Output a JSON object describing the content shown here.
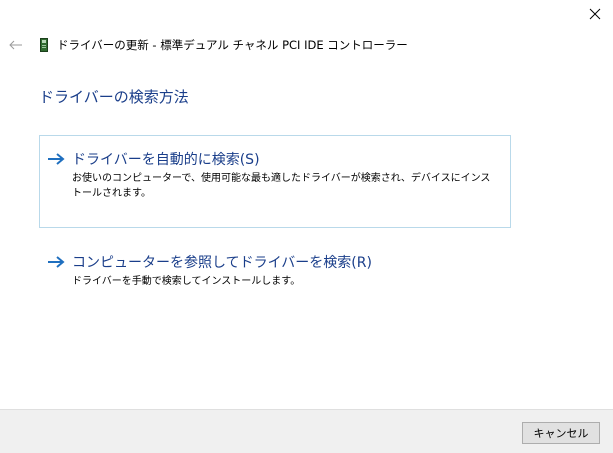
{
  "window": {
    "title": "ドライバーの更新 - 標準デュアル チャネル PCI IDE コントローラー",
    "close_icon": "close-icon",
    "back_icon": "back-arrow-icon",
    "device_icon": "device-icon"
  },
  "page": {
    "heading": "ドライバーの検索方法"
  },
  "options": [
    {
      "label": "ドライバーを自動的に検索(S)",
      "description": "お使いのコンピューターで、使用可能な最も適したドライバーが検索され、デバイスにインストールされます。",
      "icon": "arrow-right-icon",
      "selected": true
    },
    {
      "label": "コンピューターを参照してドライバーを検索(R)",
      "description": "ドライバーを手動で検索してインストールします。",
      "icon": "arrow-right-icon",
      "selected": false
    }
  ],
  "footer": {
    "cancel_label": "キャンセル"
  },
  "colors": {
    "link_blue": "#1a3e8a",
    "arrow_blue": "#1f6fbf",
    "selected_border": "#b9d9ea",
    "footer_bg": "#f0f0f0"
  }
}
